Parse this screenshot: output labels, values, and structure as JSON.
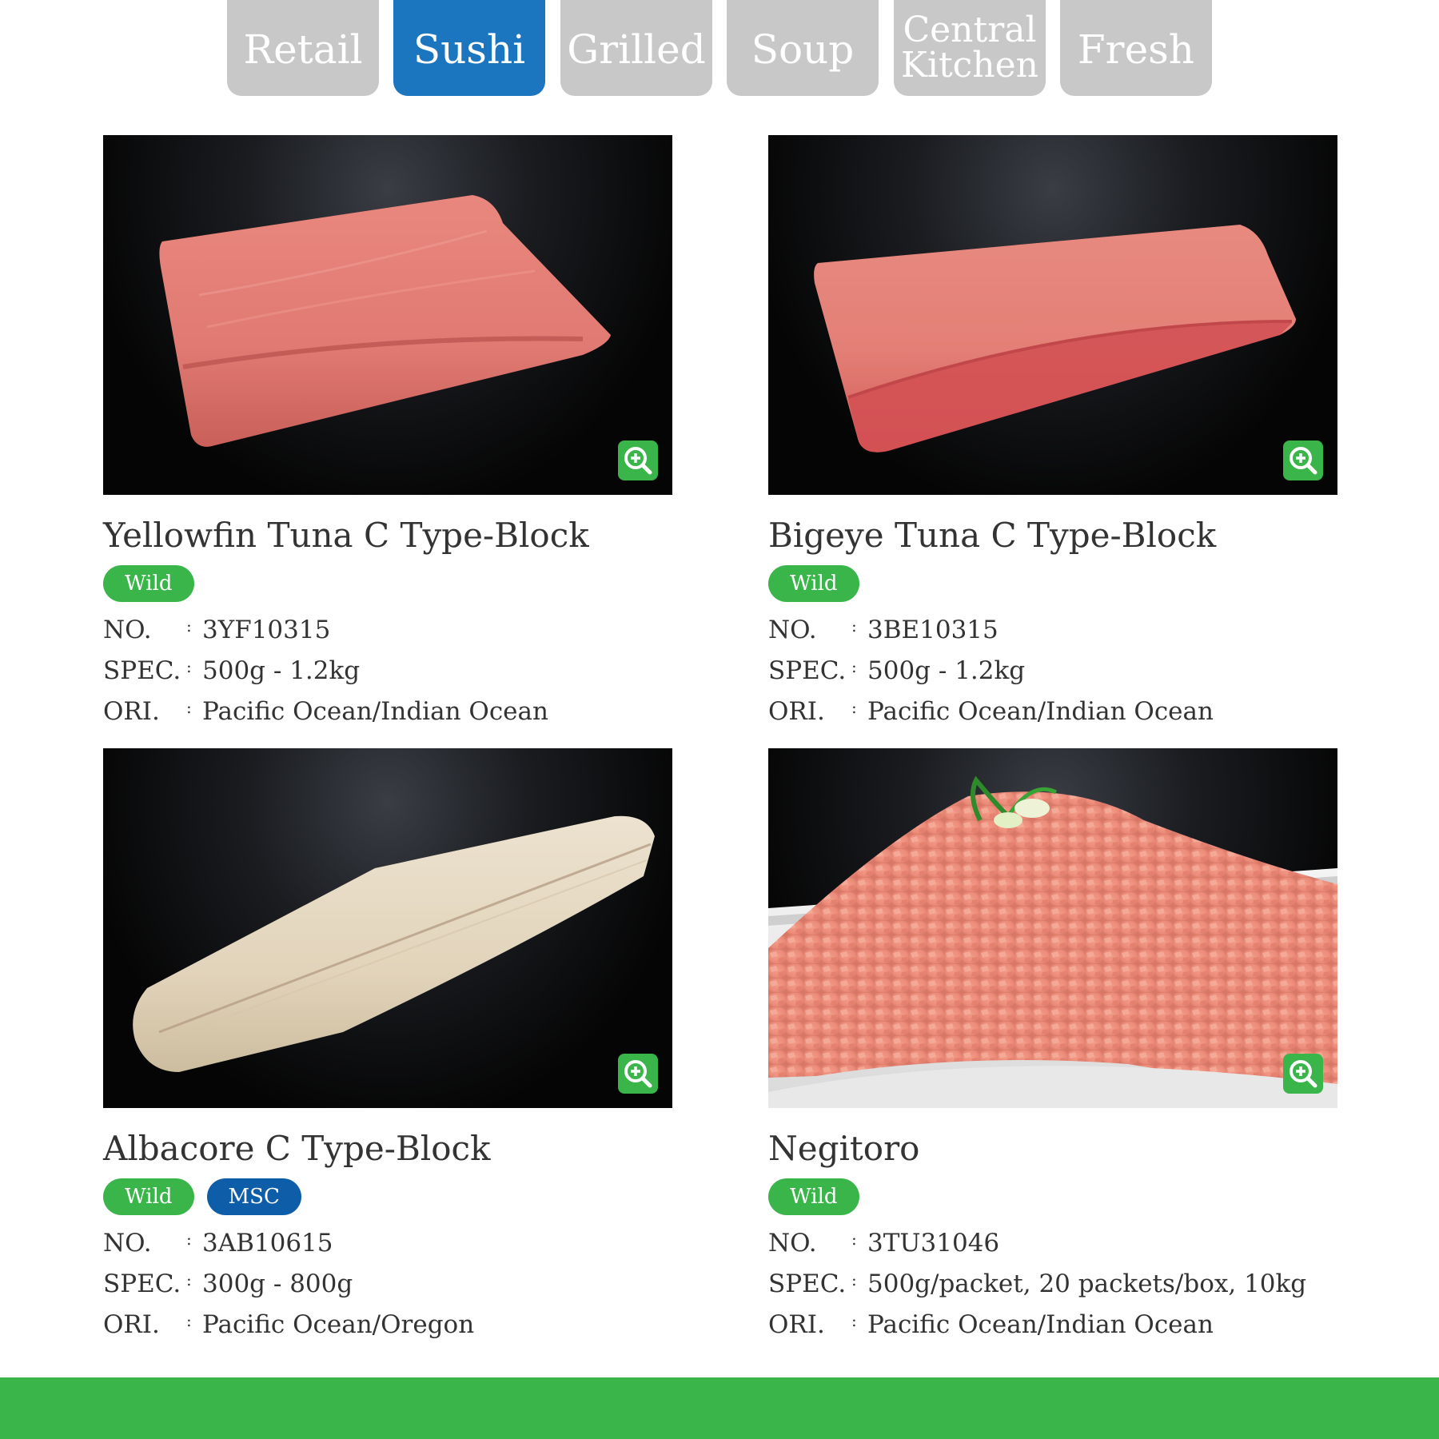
{
  "tabs": [
    {
      "label": "Retail",
      "active": false
    },
    {
      "label": "Sushi",
      "active": true
    },
    {
      "label": "Grilled",
      "active": false
    },
    {
      "label": "Soup",
      "active": false
    },
    {
      "label": "Central Kitchen",
      "active": false
    },
    {
      "label": "Fresh",
      "active": false
    }
  ],
  "field_labels": {
    "no": "NO.",
    "spec": "SPEC.",
    "ori": "ORI.",
    "colon": ":"
  },
  "products": [
    {
      "name": "Yellowfin Tuna C Type-Block",
      "badges": [
        "Wild"
      ],
      "no": "3YF10315",
      "spec": "500g - 1.2kg",
      "ori": "Pacific Ocean/Indian Ocean"
    },
    {
      "name": "Bigeye Tuna C Type-Block",
      "badges": [
        "Wild"
      ],
      "no": "3BE10315",
      "spec": "500g - 1.2kg",
      "ori": "Pacific Ocean/Indian Ocean"
    },
    {
      "name": "Albacore C Type-Block",
      "badges": [
        "Wild",
        "MSC"
      ],
      "no": "3AB10615",
      "spec": "300g - 800g",
      "ori": "Pacific Ocean/Oregon"
    },
    {
      "name": "Negitoro",
      "badges": [
        "Wild"
      ],
      "no": "3TU31046",
      "spec": "500g/packet, 20 packets/box, 10kg",
      "ori": "Pacific Ocean/Indian Ocean"
    }
  ],
  "colors": {
    "tab_inactive": "#c8c8c8",
    "tab_active": "#1c75bf",
    "badge_wild": "#39b54a",
    "badge_msc": "#0e5da8",
    "zoom_button": "#39b54a",
    "footer": "#39b54a"
  },
  "icons": {
    "zoom": "zoom-in-icon"
  }
}
